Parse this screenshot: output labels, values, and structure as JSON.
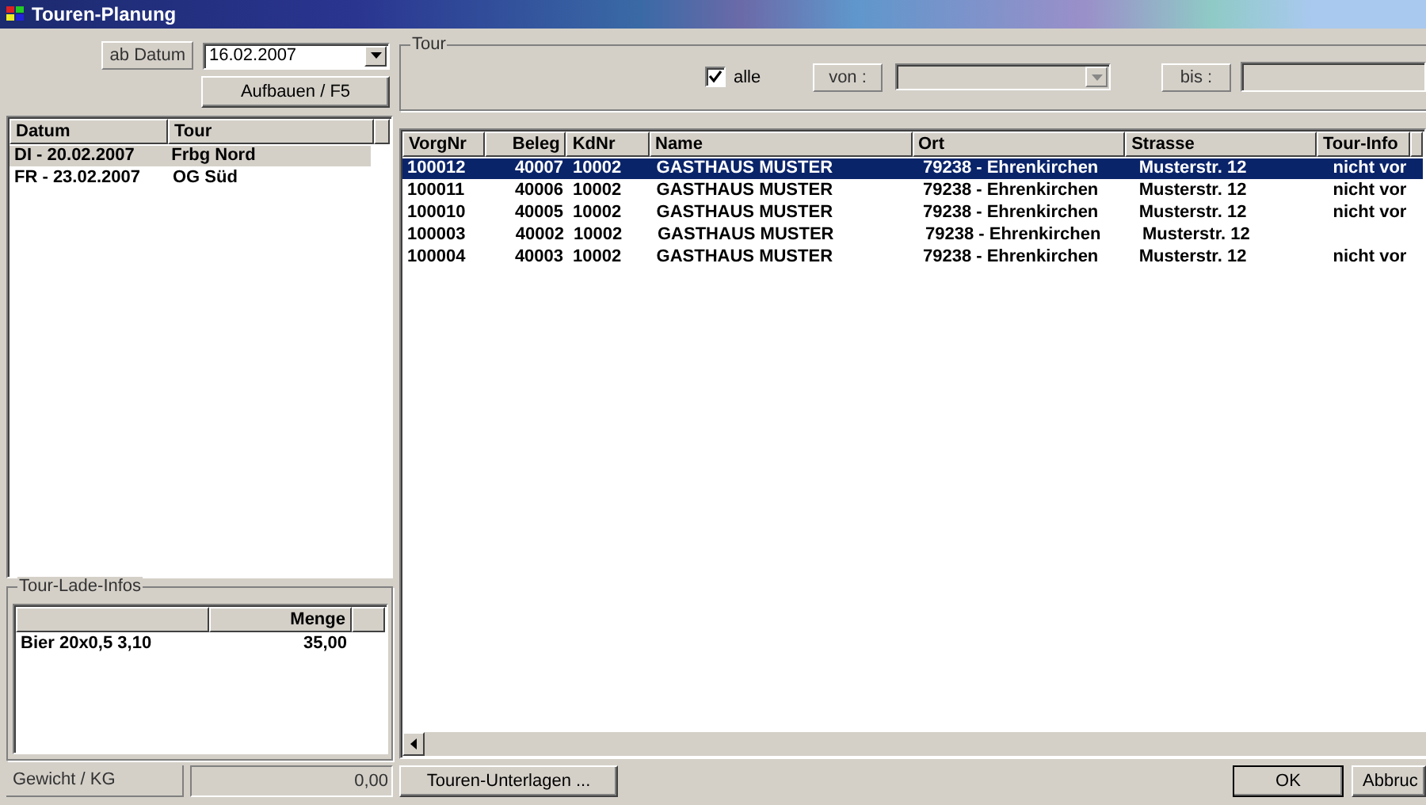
{
  "window": {
    "title": "Touren-Planung"
  },
  "date_filter": {
    "label": "ab Datum",
    "value": "16.02.2007",
    "build_button": "Aufbauen / F5"
  },
  "tour_list": {
    "columns": [
      "Datum",
      "Tour"
    ],
    "rows": [
      {
        "cells": [
          "DI - 20.02.2007",
          "Frbg Nord"
        ],
        "selected": true
      },
      {
        "cells": [
          "FR - 23.02.2007",
          "OG Süd"
        ],
        "selected": false
      }
    ]
  },
  "tour_filter": {
    "title": "Tour",
    "all_label": "alle",
    "all_checked": true,
    "from_label": "von :",
    "to_label": "bis :"
  },
  "load_info": {
    "title": "Tour-Lade-Infos",
    "columns": [
      "",
      "Menge"
    ],
    "rows": [
      {
        "cells": [
          "Bier 20x0,5  3,10",
          "35,00"
        ]
      }
    ],
    "weight_label": "Gewicht / KG",
    "weight_value": "0,00"
  },
  "orders": {
    "columns": [
      "VorgNr",
      "Beleg",
      "KdNr",
      "Name",
      "Ort",
      "Strasse",
      "Tour-Info"
    ],
    "rows": [
      {
        "cells": [
          "100012",
          "40007",
          "10002",
          "GASTHAUS MUSTER",
          "79238 - Ehrenkirchen",
          "Musterstr. 12",
          "nicht vor"
        ],
        "selected": true
      },
      {
        "cells": [
          "100011",
          "40006",
          "10002",
          "GASTHAUS MUSTER",
          "79238 - Ehrenkirchen",
          "Musterstr. 12",
          "nicht vor"
        ],
        "selected": false
      },
      {
        "cells": [
          "100010",
          "40005",
          "10002",
          "GASTHAUS MUSTER",
          "79238 - Ehrenkirchen",
          "Musterstr. 12",
          "nicht vor"
        ],
        "selected": false
      },
      {
        "cells": [
          "100003",
          "40002",
          "10002",
          "GASTHAUS MUSTER",
          "79238 - Ehrenkirchen",
          "Musterstr. 12"
        ],
        "selected": false
      },
      {
        "cells": [
          "100004",
          "40003",
          "10002",
          "GASTHAUS MUSTER",
          "79238 - Ehrenkirchen",
          "Musterstr. 12",
          "nicht vor"
        ],
        "selected": false
      }
    ]
  },
  "buttons": {
    "documents": "Touren-Unterlagen ...",
    "ok": "OK",
    "cancel": "Abbruc"
  }
}
